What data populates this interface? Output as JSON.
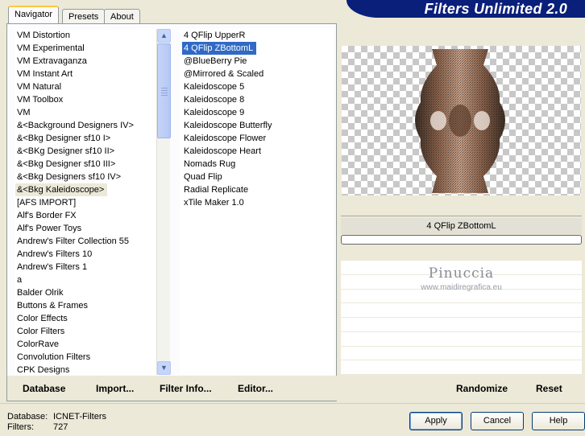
{
  "app": {
    "title": "Filters Unlimited 2.0"
  },
  "tabs": [
    {
      "label": "Navigator",
      "active": true
    },
    {
      "label": "Presets",
      "active": false
    },
    {
      "label": "About",
      "active": false
    }
  ],
  "categories": {
    "items": [
      "VM Distortion",
      "VM Experimental",
      "VM Extravaganza",
      "VM Instant Art",
      "VM Natural",
      "VM Toolbox",
      "VM",
      "&<Background Designers IV>",
      "&<Bkg Designer sf10 I>",
      "&<BKg Designer sf10 II>",
      "&<Bkg Designer sf10 III>",
      "&<Bkg Designers sf10 IV>",
      "&<Bkg Kaleidoscope>",
      "[AFS IMPORT]",
      "Alf's Border FX",
      "Alf's Power Toys",
      "Andrew's Filter Collection 55",
      "Andrew's Filters 10",
      "Andrew's Filters 1",
      "a",
      "Balder Olrik",
      "Buttons & Frames",
      "Color Effects",
      "Color Filters",
      "ColorRave",
      "Convolution Filters",
      "CPK Designs"
    ],
    "selected": "&<Bkg Kaleidoscope>"
  },
  "filters": {
    "items": [
      "4 QFlip UpperR",
      "4 QFlip ZBottomL",
      "@BlueBerry Pie",
      "@Mirrored & Scaled",
      "Kaleidoscope 5",
      "Kaleidoscope 8",
      "Kaleidoscope 9",
      "Kaleidoscope Butterfly",
      "Kaleidoscope Flower",
      "Kaleidoscope Heart",
      "Nomads Rug",
      "Quad Flip",
      "Radial Replicate",
      "xTile Maker 1.0"
    ],
    "selected": "4 QFlip ZBottomL"
  },
  "preview": {
    "filter_name": "4 QFlip ZBottomL",
    "progress": 0,
    "watermark_title": "Pinuccia",
    "watermark_url": "www.maidiregrafica.eu"
  },
  "left_actions": {
    "database": "Database",
    "import": "Import...",
    "filter_info": "Filter Info...",
    "editor": "Editor..."
  },
  "right_actions": {
    "randomize": "Randomize",
    "reset": "Reset"
  },
  "status": {
    "database_label": "Database:",
    "database_value": "ICNET-Filters",
    "filters_label": "Filters:",
    "filters_value": "727"
  },
  "buttons": {
    "apply": "Apply",
    "cancel": "Cancel",
    "help": "Help"
  },
  "colors": {
    "banner": "#0a1f7a",
    "selection": "#316ac5",
    "dialog_bg": "#ece9d8"
  }
}
